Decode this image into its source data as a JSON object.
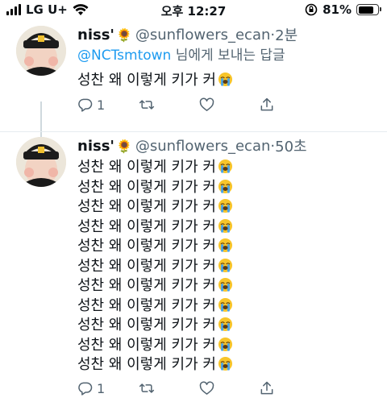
{
  "status_bar": {
    "carrier": "LG U+",
    "time": "오후 12:27",
    "battery_percent": "81%",
    "battery_level": 0.81
  },
  "tweets": [
    {
      "name": "niss'",
      "badge": "🌻",
      "handle": "@sunflowers_ecan",
      "separator": "·",
      "time": "2분",
      "reply_to_mention": "@NCTsmtown",
      "reply_suffix": " 님에게 보내는 답글",
      "text_lines": [
        "성찬 왜 이렇게 키가 커"
      ],
      "reply_count": "1",
      "icons": [
        "reply-icon",
        "retweet-icon",
        "like-icon",
        "share-icon"
      ]
    },
    {
      "name": "niss'",
      "badge": "🌻",
      "handle": "@sunflowers_ecan",
      "separator": "·",
      "time": "50초",
      "text_lines": [
        "성찬 왜 이렇게 키가 커",
        "성찬 왜 이렇게 키가 커",
        "성찬 왜 이렇게 키가 커",
        "성찬 왜 이렇게 키가 커",
        "성찬 왜 이렇게 키가 커",
        "성찬 왜 이렇게 키가 커",
        "성찬 왜 이렇게 키가 커",
        "성찬 왜 이렇게 키가 커",
        "성찬 왜 이렇게 키가 커",
        "성찬 왜 이렇게 키가 커",
        "성찬 왜 이렇게 키가 커"
      ],
      "reply_count": "1",
      "icons": [
        "reply-icon",
        "retweet-icon",
        "like-icon",
        "share-icon"
      ]
    }
  ],
  "colors": {
    "link": "#1d9bf0",
    "secondary_text": "#536471",
    "primary_text": "#0f1419"
  }
}
